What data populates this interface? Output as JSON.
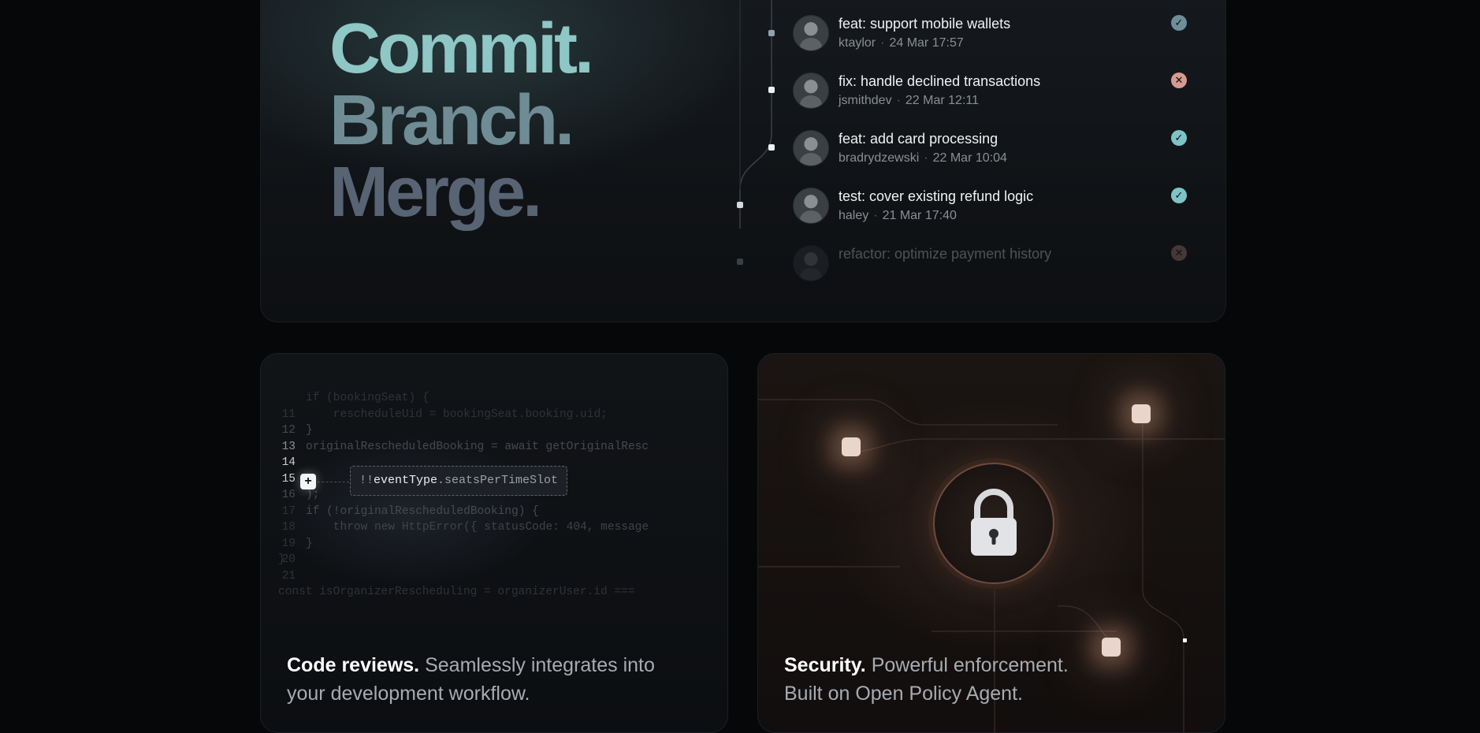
{
  "hero": {
    "headline": [
      "Commit.",
      "Branch.",
      "Merge."
    ],
    "commits": [
      {
        "message": "feat: support mobile wallets",
        "author": "ktaylor",
        "date": "24 Mar 17:57",
        "status": "success"
      },
      {
        "message": "fix: handle declined transactions",
        "author": "jsmithdev",
        "date": "22 Mar 12:11",
        "status": "failure"
      },
      {
        "message": "feat: add card processing",
        "author": "bradrydzewski",
        "date": "22 Mar 10:04",
        "status": "success"
      },
      {
        "message": "test: cover existing refund logic",
        "author": "haley",
        "date": "21 Mar 17:40",
        "status": "success"
      },
      {
        "message": "refactor: optimize payment history",
        "author": "",
        "date": "",
        "status": "failure"
      }
    ],
    "separator": "·"
  },
  "code_card": {
    "lines": [
      {
        "no": "",
        "text": "if (bookingSeat) {"
      },
      {
        "no": "11",
        "text": "    rescheduleUid = bookingSeat.booking.uid;"
      },
      {
        "no": "12",
        "text": "}"
      },
      {
        "no": "13",
        "text": "originalRescheduledBooking = await getOriginalResc"
      },
      {
        "no": "14",
        "text": ""
      },
      {
        "no": "15",
        "text": ""
      },
      {
        "no": "16",
        "text": ");"
      },
      {
        "no": "17",
        "text": "if (!originalRescheduledBooking) {"
      },
      {
        "no": "18",
        "text": "    throw new HttpError({ statusCode: 404, message"
      },
      {
        "no": "19",
        "text": "}"
      },
      {
        "no": "20",
        "text": "}"
      },
      {
        "no": "21",
        "text": ""
      },
      {
        "no": "",
        "text": "const isOrganizerRescheduling = organizerUser.id ==="
      }
    ],
    "plus_label": "+",
    "suggestion": {
      "bang": "!!",
      "obj": "eventType",
      "prop": ".seatsPerTimeSlot"
    },
    "caption_title": "Code reviews.",
    "caption_text": " Seamlessly integrates into your development workflow."
  },
  "security_card": {
    "caption_title": "Security.",
    "caption_text": " Powerful enforcement. Built on Open Policy Agent."
  },
  "colors": {
    "success": "#7fc3c6",
    "failure": "#d89a8f",
    "accent_teal": "#8fc6c6"
  }
}
